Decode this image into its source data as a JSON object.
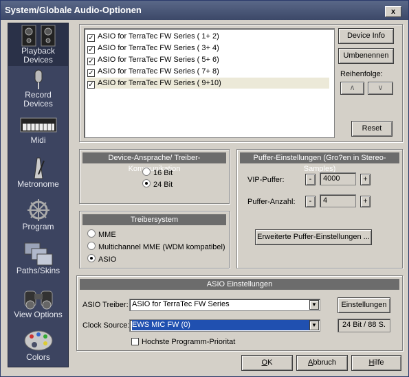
{
  "window": {
    "title": "System/Globale Audio-Optionen",
    "close_label": "x"
  },
  "sidebar": {
    "items": [
      {
        "label_line1": "Playback",
        "label_line2": "Devices",
        "icon": "speakers-icon",
        "active": true
      },
      {
        "label_line1": "Record",
        "label_line2": "Devices",
        "icon": "microphone-icon"
      },
      {
        "label_line1": "Midi",
        "label_line2": "",
        "icon": "keyboard-icon"
      },
      {
        "label_line1": "Metronome",
        "label_line2": "",
        "icon": "metronome-icon"
      },
      {
        "label_line1": "Program",
        "label_line2": "",
        "icon": "helm-icon"
      },
      {
        "label_line1": "Paths/Skins",
        "label_line2": "",
        "icon": "folders-icon"
      },
      {
        "label_line1": "View Options",
        "label_line2": "",
        "icon": "binoculars-icon"
      },
      {
        "label_line1": "Colors",
        "label_line2": "",
        "icon": "palette-icon"
      }
    ]
  },
  "devices": {
    "items": [
      {
        "label": "ASIO for TerraTec FW Series ( 1+ 2)",
        "checked": true
      },
      {
        "label": "ASIO for TerraTec FW Series ( 3+ 4)",
        "checked": true
      },
      {
        "label": "ASIO for TerraTec FW Series ( 5+ 6)",
        "checked": true
      },
      {
        "label": "ASIO for TerraTec FW Series ( 7+ 8)",
        "checked": true
      },
      {
        "label": "ASIO for TerraTec FW Series ( 9+10)",
        "checked": true,
        "selected": true
      }
    ],
    "device_info": "Device Info",
    "rename": "Umbenennen",
    "order_label": "Reihenfolge:",
    "up": "∧",
    "down": "∨",
    "reset": "Reset"
  },
  "driver_comm": {
    "title": "Device-Ansprache/ Treiber-Kommunikation",
    "options": [
      {
        "label": "16 Bit",
        "selected": false
      },
      {
        "label": "24 Bit",
        "selected": true
      }
    ]
  },
  "driver_system": {
    "title": "Treibersystem",
    "options": [
      {
        "label": "MME",
        "selected": false
      },
      {
        "label": "Multichannel MME (WDM kompatibel)",
        "selected": false
      },
      {
        "label": "ASIO",
        "selected": true
      }
    ]
  },
  "buffer": {
    "title": "Puffer-Einstellungen (Gro?en in Stereo-Samples)",
    "vip_label": "VIP-Puffer:",
    "vip_value": "4000",
    "count_label": "Puffer-Anzahl:",
    "count_value": "4",
    "minus": "-",
    "plus": "+",
    "advanced": "Erweiterte Puffer-Einstellungen ..."
  },
  "asio": {
    "title": "ASIO Einstellungen",
    "driver_label": "ASIO Treiber:",
    "driver_value": "ASIO for TerraTec FW Series",
    "settings_button": "Einstellungen",
    "clock_label": "Clock Source:",
    "clock_value": "EWS MIC FW (0)",
    "format": "24 Bit / 88 S.",
    "priority_label": "Hochste Programm-Prioritat",
    "priority_checked": false
  },
  "footer": {
    "ok_u": "O",
    "ok_rest": "K",
    "cancel_u": "A",
    "cancel_rest": "bbruch",
    "help_u": "H",
    "help_rest": "ilfe"
  }
}
